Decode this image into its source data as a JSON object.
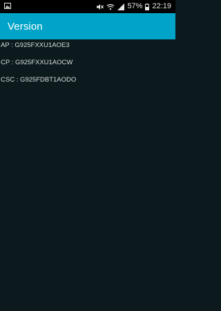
{
  "status_bar": {
    "icons": [
      "image-notification-icon",
      "mute-icon",
      "wifi-icon",
      "signal-icon",
      "battery-icon"
    ],
    "battery_percent": "57%",
    "time": "22:19"
  },
  "app_bar": {
    "title": "Version",
    "color": "#01a4c8"
  },
  "versions": [
    {
      "label": "AP",
      "separator": " : ",
      "value": "G925FXXU1AOE3",
      "text": "AP : G925FXXU1AOE3"
    },
    {
      "label": "CP",
      "separator": " : ",
      "value": "G925FXXU1AOCW",
      "text": "CP : G925FXXU1AOCW"
    },
    {
      "label": "CSC",
      "separator": " : ",
      "value": "G925FDBT1AODO",
      "text": "CSC : G925FDBT1AODO"
    }
  ]
}
